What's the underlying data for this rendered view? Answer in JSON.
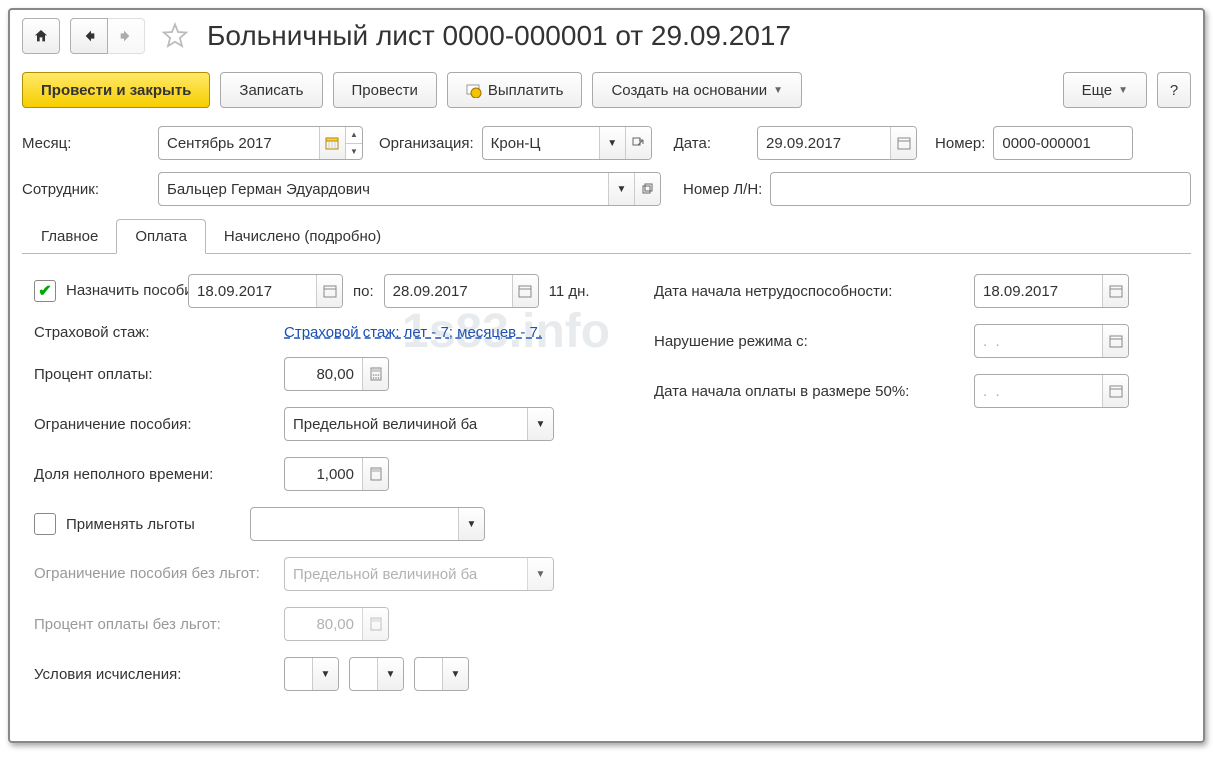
{
  "header": {
    "title": "Больничный лист 0000-000001 от 29.09.2017"
  },
  "toolbar": {
    "post_close": "Провести и закрыть",
    "save": "Записать",
    "post": "Провести",
    "pay": "Выплатить",
    "create_based": "Создать на основании",
    "more": "Еще",
    "help": "?"
  },
  "labels": {
    "month": "Месяц:",
    "org": "Организация:",
    "date": "Дата:",
    "number": "Номер:",
    "employee": "Сотрудник:",
    "ln_number": "Номер Л/Н:",
    "assign_benefit": "Назначить пособие с:",
    "to": "по:",
    "days": "11 дн.",
    "disability_start": "Дата начала нетрудоспособности:",
    "insurance_exp": "Страховой стаж:",
    "violation_from": "Нарушение режима с:",
    "pay_percent": "Процент оплаты:",
    "pay50_start": "Дата начала оплаты в размере 50%:",
    "benefit_limit": "Ограничение пособия:",
    "parttime": "Доля неполного времени:",
    "apply_benefits": "Применять льготы",
    "limit_no_benefits": "Ограничение пособия без льгот:",
    "percent_no_benefits": "Процент оплаты без льгот:",
    "calc_conditions": "Условия исчисления:"
  },
  "values": {
    "month": "Сентябрь 2017",
    "org": "Крон-Ц",
    "date": "29.09.2017",
    "number": "0000-000001",
    "employee": "Бальцер Герман Эдуардович",
    "ln_number": "",
    "from_date": "18.09.2017",
    "to_date": "28.09.2017",
    "disability_start": "18.09.2017",
    "insurance_link": "Страховой стаж: лет - 7;  месяцев - 7.",
    "pay_percent": "80,00",
    "benefit_limit": "Предельной величиной ба",
    "parttime": "1,000",
    "limit_no_benefits": "Предельной величиной ба",
    "percent_no_benefits": "80,00",
    "empty_date": ".  .",
    "violation_date": ".  ."
  },
  "tabs": {
    "main": "Главное",
    "payment": "Оплата",
    "accrued": "Начислено (подробно)"
  },
  "watermark": "1s83.info"
}
